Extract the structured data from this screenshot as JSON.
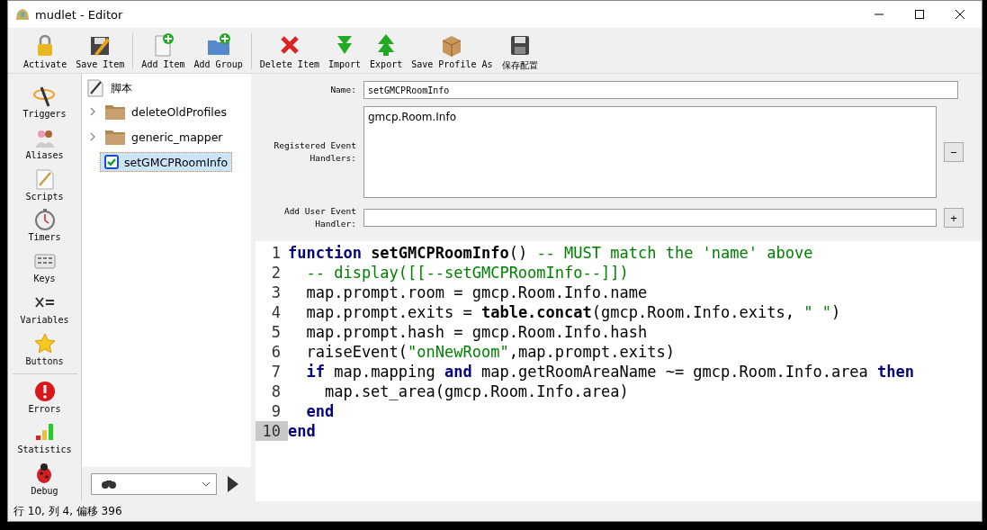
{
  "window": {
    "title": "mudlet - Editor"
  },
  "toolbar": [
    {
      "label": "Activate"
    },
    {
      "label": "Save Item"
    },
    {
      "label": "Add Item"
    },
    {
      "label": "Add Group"
    },
    {
      "label": "Delete Item"
    },
    {
      "label": "Import"
    },
    {
      "label": "Export"
    },
    {
      "label": "Save Profile As"
    },
    {
      "label": "保存配置"
    }
  ],
  "sidebar": {
    "items": [
      {
        "label": "Triggers"
      },
      {
        "label": "Aliases"
      },
      {
        "label": "Scripts"
      },
      {
        "label": "Timers"
      },
      {
        "label": "Keys"
      },
      {
        "label": "Variables"
      },
      {
        "label": "Buttons"
      },
      {
        "label": "Errors"
      },
      {
        "label": "Statistics"
      },
      {
        "label": "Debug"
      }
    ]
  },
  "tree": {
    "root": "脚本",
    "children": [
      {
        "label": "deleteOldProfiles",
        "kind": "folder",
        "expanded": false,
        "selected": false
      },
      {
        "label": "generic_mapper",
        "kind": "folder",
        "expanded": false,
        "selected": false
      },
      {
        "label": "setGMCPRoomInfo",
        "kind": "script",
        "active": true,
        "selected": true
      }
    ]
  },
  "form": {
    "name_label": "Name:",
    "name_value": "setGMCPRoomInfo",
    "handlers_label": "Registered Event Handlers:",
    "handlers": [
      "gmcp.Room.Info"
    ],
    "remove_button": "−",
    "add_label": "Add User Event Handler:",
    "add_button": "+"
  },
  "editor": {
    "lines": [
      {
        "number": "1",
        "current": false,
        "tokens": [
          {
            "kind": "kw",
            "text": "function "
          },
          {
            "kind": "bold",
            "text": "setGMCPRoomInfo"
          },
          {
            "kind": "plain",
            "text": "() "
          },
          {
            "kind": "comment",
            "text": "-- MUST match the 'name' above"
          }
        ]
      },
      {
        "number": "2",
        "current": false,
        "tokens": [
          {
            "kind": "comment",
            "text": "  -- display([[--setGMCPRoomInfo--]])"
          }
        ]
      },
      {
        "number": "3",
        "current": false,
        "tokens": [
          {
            "kind": "plain",
            "text": "  map.prompt.room = gmcp.Room.Info.name"
          }
        ]
      },
      {
        "number": "4",
        "current": false,
        "tokens": [
          {
            "kind": "plain",
            "text": "  map.prompt.exits = "
          },
          {
            "kind": "bold",
            "text": "table.concat"
          },
          {
            "kind": "plain",
            "text": "(gmcp.Room.Info.exits, "
          },
          {
            "kind": "string",
            "text": "\" \""
          },
          {
            "kind": "plain",
            "text": ")"
          }
        ]
      },
      {
        "number": "5",
        "current": false,
        "tokens": [
          {
            "kind": "plain",
            "text": "  map.prompt.hash = gmcp.Room.Info.hash"
          }
        ]
      },
      {
        "number": "6",
        "current": false,
        "tokens": [
          {
            "kind": "plain",
            "text": "  raiseEvent("
          },
          {
            "kind": "string",
            "text": "\"onNewRoom\""
          },
          {
            "kind": "plain",
            "text": ",map.prompt.exits)"
          }
        ]
      },
      {
        "number": "7",
        "current": false,
        "tokens": [
          {
            "kind": "kw",
            "text": "  if"
          },
          {
            "kind": "plain",
            "text": " map.mapping "
          },
          {
            "kind": "kw",
            "text": "and"
          },
          {
            "kind": "plain",
            "text": " map.getRoomAreaName ~= gmcp.Room.Info.area "
          },
          {
            "kind": "kw",
            "text": "then"
          }
        ]
      },
      {
        "number": "8",
        "current": false,
        "tokens": [
          {
            "kind": "plain",
            "text": "    map.set_area(gmcp.Room.Info.area)"
          }
        ]
      },
      {
        "number": "9",
        "current": false,
        "tokens": [
          {
            "kind": "kw",
            "text": "  end"
          }
        ]
      },
      {
        "number": "10",
        "current": true,
        "tokens": [
          {
            "kind": "kw",
            "text": "end"
          }
        ]
      }
    ]
  },
  "status_bar": "行 10, 列 4, 偏移 396"
}
